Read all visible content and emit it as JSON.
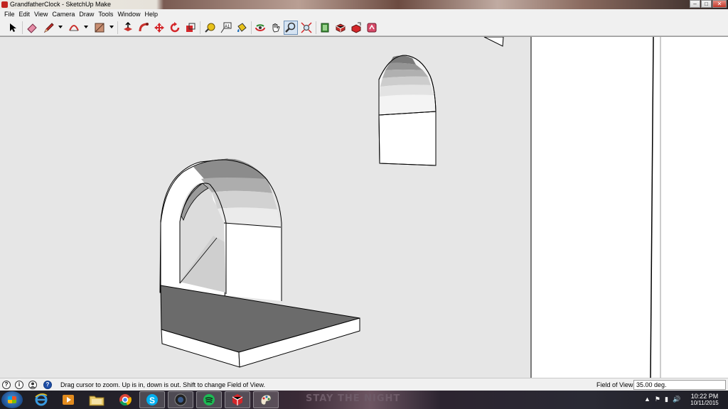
{
  "window": {
    "title": "GrandfatherClock - SketchUp Make",
    "controls": {
      "minimize": "–",
      "maximize": "□",
      "close": "✕"
    }
  },
  "menu": [
    "File",
    "Edit",
    "View",
    "Camera",
    "Draw",
    "Tools",
    "Window",
    "Help"
  ],
  "toolbar": {
    "tools": [
      {
        "name": "select-tool-icon",
        "active": false
      },
      {
        "name": "eraser-tool-icon",
        "active": false
      },
      {
        "name": "pencil-line-tool-icon",
        "active": false
      },
      {
        "name": "arc-tool-icon",
        "active": false
      },
      {
        "name": "rectangle-tool-icon",
        "active": false
      },
      {
        "name": "push-pull-tool-icon",
        "active": false
      },
      {
        "name": "follow-me-tool-icon",
        "active": false
      },
      {
        "name": "move-tool-icon",
        "active": false
      },
      {
        "name": "rotate-tool-icon",
        "active": false
      },
      {
        "name": "scale-tool-icon",
        "active": false
      },
      {
        "name": "tape-measure-tool-icon",
        "active": false
      },
      {
        "name": "text-tool-icon",
        "active": false
      },
      {
        "name": "paint-bucket-tool-icon",
        "active": false
      },
      {
        "name": "orbit-tool-icon",
        "active": false
      },
      {
        "name": "pan-tool-icon",
        "active": false
      },
      {
        "name": "zoom-tool-icon",
        "active": true
      },
      {
        "name": "zoom-extents-tool-icon",
        "active": false
      },
      {
        "name": "warehouse-icon",
        "active": false
      },
      {
        "name": "get-models-icon",
        "active": false
      },
      {
        "name": "share-model-icon",
        "active": false
      },
      {
        "name": "extension-warehouse-icon",
        "active": false
      }
    ],
    "text_tool_glyph": "A1"
  },
  "status": {
    "icons": [
      "help-icon",
      "info-icon",
      "user-icon",
      "geo-location-icon"
    ],
    "icon_glyphs": [
      "?",
      "i",
      "",
      "?"
    ],
    "message": "Drag cursor to zoom.  Up is in, down is out. Shift to change Field of View.",
    "vcb_label": "Field of View",
    "vcb_value": "35.00 deg."
  },
  "taskbar": {
    "apps": [
      "internet-explorer-icon",
      "media-player-icon",
      "file-explorer-icon",
      "chrome-icon",
      "skype-icon",
      "camera-app-icon",
      "spotify-icon",
      "sketchup-icon",
      "paint-icon"
    ],
    "skype_glyph": "S",
    "banner": "STAY THE NIGHT",
    "tray_glyphs": [
      "▲",
      "⚑",
      "▮",
      "🔊"
    ],
    "time": "10:22 PM",
    "date": "10/11/2015"
  },
  "colors": {
    "wall": "#e6e6e6",
    "arch_face": "#ffffff",
    "shelf_top": "#6b6b6b",
    "zoom_active": "#d5e3f2"
  }
}
